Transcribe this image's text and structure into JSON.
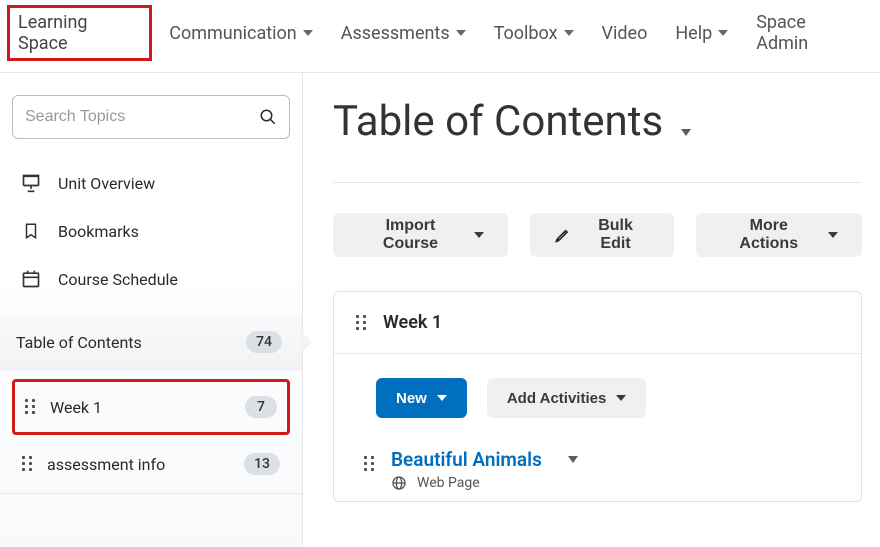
{
  "topnav": {
    "items": [
      {
        "label": "Learning Space",
        "hasDropdown": false
      },
      {
        "label": "Communication",
        "hasDropdown": true
      },
      {
        "label": "Assessments",
        "hasDropdown": true
      },
      {
        "label": "Toolbox",
        "hasDropdown": true
      },
      {
        "label": "Video",
        "hasDropdown": false
      },
      {
        "label": "Help",
        "hasDropdown": true
      },
      {
        "label": "Space Admin",
        "hasDropdown": false
      }
    ]
  },
  "search": {
    "placeholder": "Search Topics"
  },
  "sidebar": {
    "primary": [
      {
        "label": "Unit Overview"
      },
      {
        "label": "Bookmarks"
      },
      {
        "label": "Course Schedule"
      }
    ],
    "toc_label": "Table of Contents",
    "toc_count": "74",
    "modules": [
      {
        "label": "Week 1",
        "count": "7"
      },
      {
        "label": "assessment info",
        "count": "13"
      }
    ]
  },
  "page": {
    "title": "Table of Contents",
    "actions": {
      "import": "Import Course",
      "bulk_edit": "Bulk Edit",
      "more_actions": "More Actions"
    },
    "module": {
      "title": "Week 1",
      "new_label": "New",
      "add_activities": "Add Activities",
      "topic": {
        "title": "Beautiful Animals",
        "type": "Web Page"
      }
    }
  }
}
